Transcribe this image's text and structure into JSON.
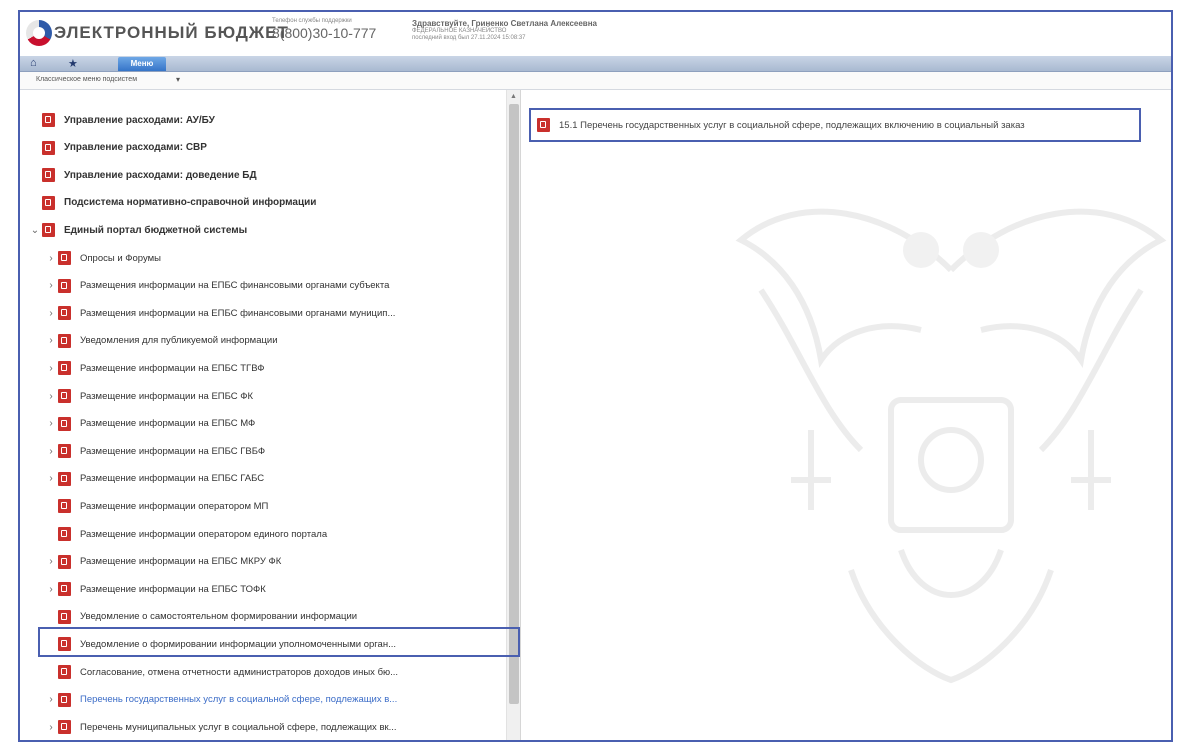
{
  "header": {
    "logo_text": "ЭЛЕКТРОННЫЙ БЮДЖЕТ",
    "support_label": "Телефон службы поддержки",
    "support_phone": "8(800)30-10-777",
    "user_name": "Здравствуйте, Гриненко Светлана Алексеевна",
    "user_org": "ФЕДЕРАЛЬНОЕ КАЗНАЧЕЙСТВО",
    "user_last_login": "последний вход был 27.11.2024 15:08:37"
  },
  "menubar": {
    "home_icon": "home-icon",
    "favorites_icon": "star-icon",
    "menu_label": "Меню"
  },
  "submenu": {
    "label": "Классическое меню подсистем",
    "caret": "▾"
  },
  "tree": [
    {
      "label": "Управление расходами: АУ/БУ",
      "bold": true,
      "expander": ""
    },
    {
      "label": "Управление расходами: СВР",
      "bold": true,
      "expander": ""
    },
    {
      "label": "Управление расходами: доведение БД",
      "bold": true,
      "expander": ""
    },
    {
      "label": "Подсистема нормативно-справочной информации",
      "bold": true,
      "expander": ""
    },
    {
      "label": "Единый портал бюджетной системы",
      "bold": true,
      "expander": "⌄"
    },
    {
      "label": "Опросы и Форумы",
      "bold": false,
      "expander": "›"
    },
    {
      "label": "Размещения информации на ЕПБС финансовыми органами субъекта",
      "bold": false,
      "expander": "›"
    },
    {
      "label": "Размещения информации на ЕПБС финансовыми органами муницип...",
      "bold": false,
      "expander": "›"
    },
    {
      "label": "Уведомления для публикуемой информации",
      "bold": false,
      "expander": "›"
    },
    {
      "label": "Размещение информации на ЕПБС ТГВФ",
      "bold": false,
      "expander": "›"
    },
    {
      "label": "Размещение информации на ЕПБС ФК",
      "bold": false,
      "expander": "›"
    },
    {
      "label": "Размещение информации на ЕПБС МФ",
      "bold": false,
      "expander": "›"
    },
    {
      "label": "Размещение информации на ЕПБС ГВБФ",
      "bold": false,
      "expander": "›"
    },
    {
      "label": "Размещение информации на ЕПБС ГАБС",
      "bold": false,
      "expander": "›"
    },
    {
      "label": "Размещение информации оператором МП",
      "bold": false,
      "expander": ""
    },
    {
      "label": "Размещение информации оператором единого портала",
      "bold": false,
      "expander": ""
    },
    {
      "label": "Размещение информации на ЕПБС МКРУ ФК",
      "bold": false,
      "expander": "›"
    },
    {
      "label": "Размещение информации на ЕПБС ТОФК",
      "bold": false,
      "expander": "›"
    },
    {
      "label": "Уведомление о самостоятельном формировании информации",
      "bold": false,
      "expander": ""
    },
    {
      "label": "Уведомление о формировании информации уполномоченными орган...",
      "bold": false,
      "expander": ""
    },
    {
      "label": "Согласование, отмена отчетности администраторов доходов иных бю...",
      "bold": false,
      "expander": ""
    },
    {
      "label": "Перечень государственных услуг в социальной сфере, подлежащих в...",
      "bold": false,
      "expander": "›",
      "selected": true
    },
    {
      "label": "Перечень муниципальных услуг в социальной сфере, подлежащих вк...",
      "bold": false,
      "expander": "›"
    }
  ],
  "right_item": {
    "label": "15.1 Перечень государственных услуг в социальной сфере, подлежащих включению в социальный заказ"
  }
}
